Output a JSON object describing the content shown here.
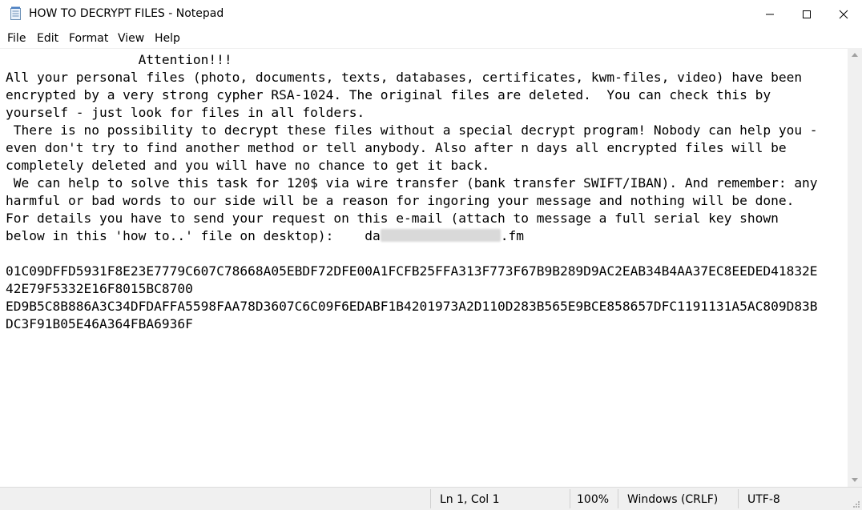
{
  "window": {
    "title": "HOW TO DECRYPT FILES - Notepad",
    "minimize_glyph": "minimize-icon",
    "maximize_glyph": "maximize-icon",
    "close_glyph": "close-icon"
  },
  "menu": [
    "File",
    "Edit",
    "Format",
    "View",
    "Help"
  ],
  "document": {
    "lines": [
      "                 Attention!!!",
      "All your personal files (photo, documents, texts, databases, certificates, kwm-files, video) have been",
      "encrypted by a very strong cypher RSA-1024. The original files are deleted.  You can check this by",
      "yourself - just look for files in all folders.",
      " There is no possibility to decrypt these files without a special decrypt program! Nobody can help you -",
      "even don't try to find another method or tell anybody. Also after n days all encrypted files will be",
      "completely deleted and you will have no chance to get it back.",
      " We can help to solve this task for 120$ via wire transfer (bank transfer SWIFT/IBAN). And remember: any",
      "harmful or bad words to our side will be a reason for ingoring your message and nothing will be done.",
      "For details you have to send your request on this e-mail (attach to message a full serial key shown",
      "",
      "",
      "01C09DFFD5931F8E23E7779C607C78668A05EBDF72DFE00A1FCFB25FFA313F773F67B9B289D9AC2EAB34B4AA37EC8EEDED41832E",
      "42E79F5332E16F8015BC8700",
      "ED9B5C8B886A3C34DFDAFFA5598FAA78D3607C6C09F6EDABF1B4201973A2D110D283B565E9BCE858657DFC1191131A5AC809D83B",
      "DC3F91B05E46A364FBA6936F"
    ],
    "email_line_prefix": "below in this 'how to..' file on desktop):    da",
    "email_line_suffix": ".fm"
  },
  "status": {
    "position": "Ln 1, Col 1",
    "zoom": "100%",
    "line_endings": "Windows (CRLF)",
    "encoding": "UTF-8"
  }
}
